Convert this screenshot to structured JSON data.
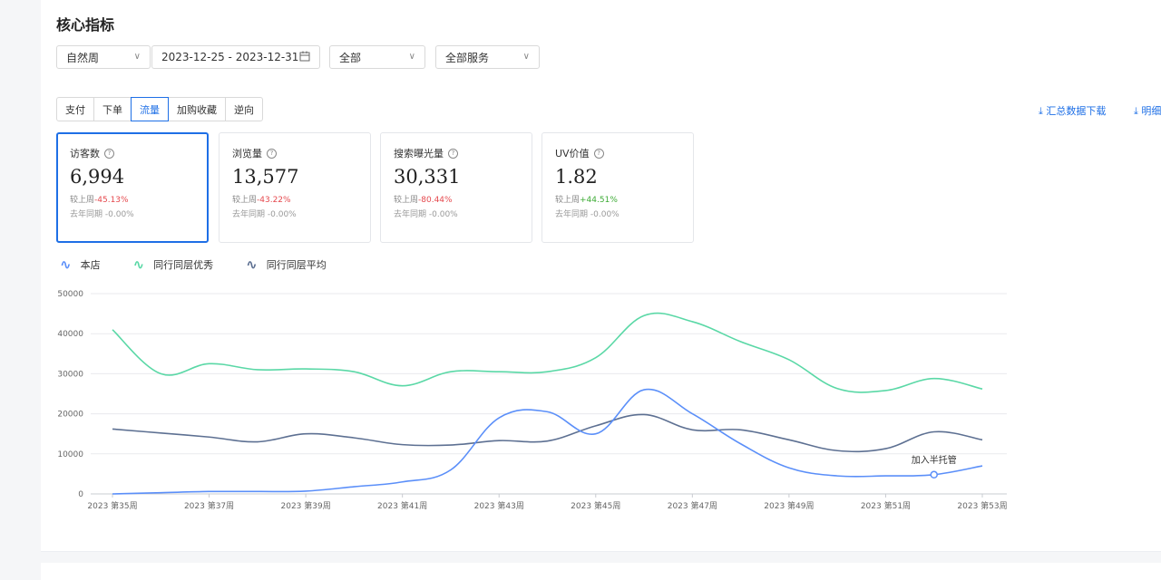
{
  "section_title": "核心指标",
  "filters": {
    "period_type": "自然周",
    "date_range": "2023-12-25 - 2023-12-31",
    "scope": "全部",
    "service": "全部服务"
  },
  "tabs": [
    {
      "label": "支付",
      "active": false
    },
    {
      "label": "下单",
      "active": false
    },
    {
      "label": "流量",
      "active": true
    },
    {
      "label": "加购收藏",
      "active": false
    },
    {
      "label": "逆向",
      "active": false
    }
  ],
  "downloads": {
    "summary": "⤓ 汇总数据下载",
    "detail": "⤓ 明细"
  },
  "kpis": [
    {
      "label": "访客数",
      "value": "6,994",
      "wow_label": "较上周",
      "wow": "-45.13%",
      "trend": "down",
      "yoy_label": "去年同期",
      "yoy": "-0.00%",
      "active": true
    },
    {
      "label": "浏览量",
      "value": "13,577",
      "wow_label": "较上周",
      "wow": "-43.22%",
      "trend": "down",
      "yoy_label": "去年同期",
      "yoy": "-0.00%",
      "active": false
    },
    {
      "label": "搜索曝光量",
      "value": "30,331",
      "wow_label": "较上周",
      "wow": "-80.44%",
      "trend": "down",
      "yoy_label": "去年同期",
      "yoy": "-0.00%",
      "active": false
    },
    {
      "label": "UV价值",
      "value": "1.82",
      "wow_label": "较上周",
      "wow": "+44.51%",
      "trend": "up",
      "yoy_label": "去年同期",
      "yoy": "-0.00%",
      "active": false
    }
  ],
  "colors": {
    "accent": "#1e6fe6",
    "series_store": "#5b8ff9",
    "series_excellent": "#5ad8a6",
    "series_average": "#5d7092",
    "down": "#e5484d",
    "up": "#3dab35"
  },
  "chart_data": {
    "type": "line",
    "x": [
      "2023 第35周",
      "2023 第36周",
      "2023 第37周",
      "2023 第38周",
      "2023 第39周",
      "2023 第40周",
      "2023 第41周",
      "2023 第42周",
      "2023 第43周",
      "2023 第44周",
      "2023 第45周",
      "2023 第46周",
      "2023 第47周",
      "2023 第48周",
      "2023 第49周",
      "2023 第50周",
      "2023 第51周",
      "2023 第52周",
      "2023 第53周"
    ],
    "tick_labels": [
      "2023 第35周",
      "2023 第37周",
      "2023 第39周",
      "2023 第41周",
      "2023 第43周",
      "2023 第45周",
      "2023 第47周",
      "2023 第49周",
      "2023 第51周",
      "2023 第53周"
    ],
    "yticks": [
      "0",
      "10000",
      "20000",
      "30000",
      "40000",
      "50000"
    ],
    "ylim": [
      0,
      50000
    ],
    "grid": true,
    "legend_position": "top-left",
    "series": [
      {
        "name": "本店",
        "values": [
          0,
          300,
          600,
          600,
          700,
          1800,
          3000,
          6000,
          19000,
          20500,
          15000,
          26000,
          20000,
          12500,
          6500,
          4500,
          4500,
          4800,
          7000
        ]
      },
      {
        "name": "同行同层优秀",
        "values": [
          41000,
          30000,
          32500,
          31000,
          31200,
          30500,
          27000,
          30500,
          30500,
          30500,
          34000,
          44500,
          43000,
          38000,
          33500,
          26300,
          25800,
          28800,
          26200
        ]
      },
      {
        "name": "同行同层平均",
        "values": [
          16200,
          15200,
          14200,
          13000,
          15000,
          14000,
          12300,
          12200,
          13300,
          13200,
          17000,
          19800,
          16000,
          16000,
          13500,
          10800,
          11300,
          15500,
          13500
        ]
      }
    ],
    "annotation": {
      "text": "加入半托管",
      "series": "本店",
      "x": "2023 第52周"
    }
  }
}
